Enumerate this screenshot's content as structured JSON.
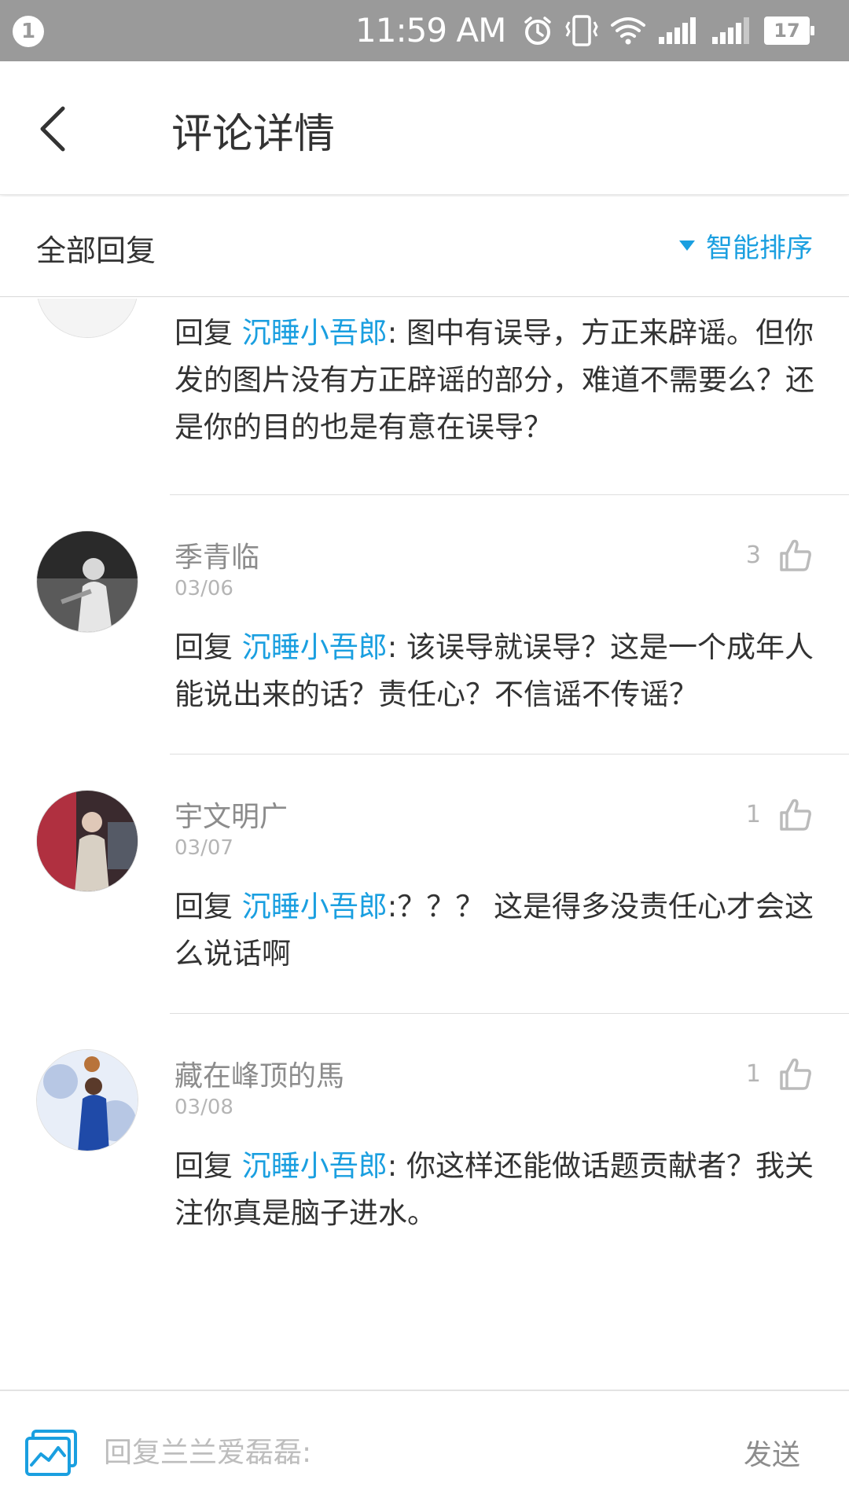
{
  "status_bar": {
    "notification_count": "1",
    "time": "11:59 AM",
    "battery": "17",
    "icons": [
      "alarm-icon",
      "vibrate-icon",
      "wifi-icon",
      "signal-icon",
      "signal-icon"
    ]
  },
  "header": {
    "title": "评论详情",
    "back_icon": "chevron-left-icon"
  },
  "filter": {
    "all_replies": "全部回复",
    "sort_label": "智能排序"
  },
  "comments": [
    {
      "reply_prefix": "回复",
      "mention": "沉睡小吾郎",
      "text": ": 图中有误导，方正来辟谣。但你发的图片没有方正辟谣的部分，难道不需要么？还是你的目的也是有意在误导？"
    },
    {
      "name": "季青临",
      "date": "03/06",
      "likes": "3",
      "reply_prefix": "回复",
      "mention": "沉睡小吾郎",
      "text": ": 该误导就误导？这是一个成年人能说出来的话？责任心？不信谣不传谣？"
    },
    {
      "name": "宇文明广",
      "date": "03/07",
      "likes": "1",
      "reply_prefix": "回复",
      "mention": "沉睡小吾郎",
      "text": ":？？？ 这是得多没责任心才会这么说话啊"
    },
    {
      "name": "藏在峰顶的馬",
      "date": "03/08",
      "likes": "1",
      "reply_prefix": "回复",
      "mention": "沉睡小吾郎",
      "text": ": 你这样还能做话题贡献者？我关注你真是脑子进水。"
    }
  ],
  "input_bar": {
    "placeholder": "回复兰兰爱磊磊:",
    "send_label": "发送",
    "image_icon": "image-icon"
  },
  "colors": {
    "accent": "#1a9fe0",
    "status_bar": "#9a9a9a"
  }
}
